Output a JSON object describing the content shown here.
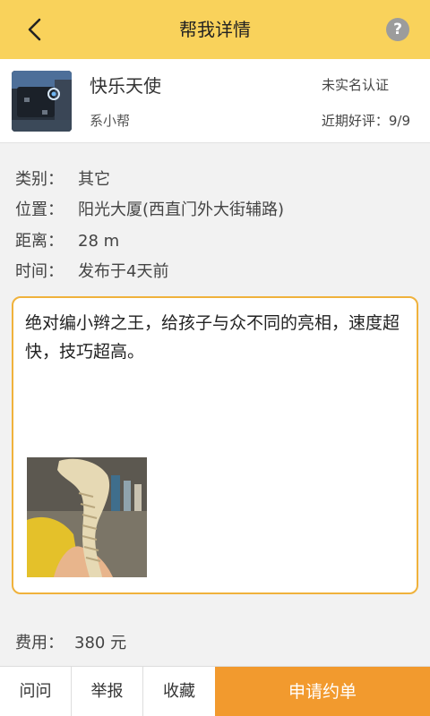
{
  "header": {
    "title": "帮我详情",
    "help_symbol": "?",
    "back_icon": "chevron-left-icon",
    "background_color": "#f9d25b"
  },
  "profile": {
    "name": "快乐天使",
    "tag": "系小帮",
    "verification": "未实名认证",
    "rating_label": "近期好评：",
    "rating_value": "9/9"
  },
  "details": {
    "category_label": "类别：",
    "category_value": "其它",
    "location_label": "位置：",
    "location_value": "阳光大厦(西直门外大街辅路)",
    "distance_label": "距离：",
    "distance_value": "28 m",
    "time_label": "时间：",
    "time_value": "发布于4天前"
  },
  "description": {
    "text": "绝对编小辫之王，给孩子与众不同的亮相，速度超快，技巧超高。",
    "border_color": "#f0b23c"
  },
  "fee": {
    "label": "费用：",
    "value": "380 元"
  },
  "bottom_bar": {
    "ask_label": "问问",
    "report_label": "举报",
    "favorite_label": "收藏",
    "apply_label": "申请约单",
    "apply_color": "#f29a2e"
  }
}
